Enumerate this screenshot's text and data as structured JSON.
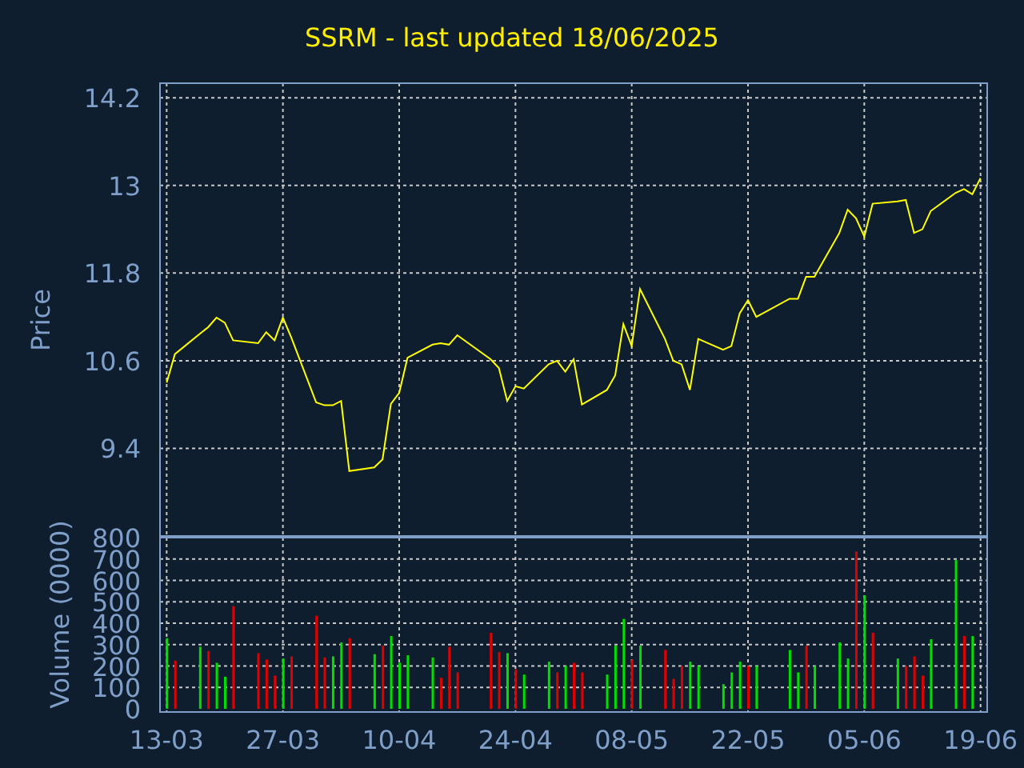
{
  "title": "SSRM - last updated 18/06/2025",
  "price_chart": {
    "chart_data": {
      "type": "line",
      "ylabel": "Price",
      "categories": [
        null,
        null,
        null,
        null,
        null,
        null,
        null,
        null,
        null,
        null,
        null,
        null,
        null,
        null,
        null,
        null,
        null,
        null,
        null,
        null,
        null,
        null,
        null,
        null,
        null,
        null,
        null,
        null,
        null,
        null,
        null,
        null,
        null,
        null,
        null,
        null,
        null,
        null,
        null,
        null,
        null,
        null,
        null,
        null,
        null,
        null,
        null,
        null,
        null,
        null,
        null,
        null,
        null,
        null,
        null,
        null,
        null,
        null,
        null,
        null,
        null,
        null,
        null,
        null,
        null,
        null,
        null,
        null,
        null,
        null,
        null,
        null,
        null,
        null,
        null,
        null,
        null,
        null,
        null,
        null,
        null,
        null,
        null,
        null,
        null,
        null,
        null,
        null,
        null,
        null,
        null,
        null,
        null,
        null,
        null,
        null,
        null,
        null,
        null
      ],
      "series": [
        {
          "color": "#ffff00",
          "values": [
            10.3,
            10.69,
            null,
            null,
            10.97,
            11.06,
            11.19,
            11.12,
            10.88,
            null,
            null,
            10.84,
            10.99,
            10.88,
            11.19,
            10.92,
            null,
            null,
            10.03,
            9.99,
            9.99,
            10.05,
            9.09,
            null,
            null,
            9.14,
            9.25,
            10.01,
            10.16,
            10.64,
            null,
            null,
            10.82,
            10.84,
            10.82,
            10.95,
            null,
            null,
            null,
            10.62,
            10.5,
            10.05,
            10.25,
            10.22,
            null,
            null,
            10.55,
            10.6,
            10.45,
            10.62,
            10.0,
            null,
            null,
            10.2,
            10.4,
            11.1,
            10.8,
            11.58,
            null,
            null,
            10.9,
            10.6,
            10.55,
            10.2,
            10.9,
            null,
            null,
            10.75,
            10.8,
            11.25,
            11.43,
            11.2,
            null,
            null,
            null,
            11.45,
            11.45,
            11.75,
            11.75,
            null,
            null,
            12.35,
            12.67,
            12.55,
            12.3,
            12.75,
            null,
            null,
            12.78,
            12.8,
            12.35,
            12.4,
            12.65,
            null,
            null,
            12.9,
            12.95,
            12.88,
            13.1
          ]
        }
      ],
      "grid": true,
      "ylim": [
        8.2,
        14.4
      ],
      "yticks": [
        9.4,
        10.6,
        11.8,
        13,
        14.2
      ]
    }
  },
  "volume_chart": {
    "chart_data": {
      "type": "bar",
      "ylabel": "Volume (0000)",
      "stacked": true,
      "categories": [
        "13-03",
        null,
        null,
        null,
        null,
        null,
        null,
        null,
        null,
        null,
        null,
        null,
        null,
        null,
        "27-03",
        null,
        null,
        null,
        null,
        null,
        null,
        null,
        null,
        null,
        null,
        null,
        null,
        null,
        "10-04",
        null,
        null,
        null,
        null,
        null,
        null,
        null,
        null,
        null,
        null,
        null,
        null,
        null,
        "24-04",
        null,
        null,
        null,
        null,
        null,
        null,
        null,
        null,
        null,
        null,
        null,
        null,
        null,
        "08-05",
        null,
        null,
        null,
        null,
        null,
        null,
        null,
        null,
        null,
        null,
        null,
        null,
        null,
        "22-05",
        null,
        null,
        null,
        null,
        null,
        null,
        null,
        null,
        null,
        null,
        null,
        null,
        null,
        "05-06",
        null,
        null,
        null,
        null,
        null,
        null,
        null,
        null,
        null,
        null,
        null,
        null,
        null,
        "19-06"
      ],
      "series": [
        {
          "color": "#00e000",
          "values": [
            330,
            null,
            null,
            null,
            290,
            null,
            215,
            150,
            null,
            null,
            null,
            null,
            null,
            null,
            235,
            null,
            null,
            null,
            null,
            null,
            245,
            310,
            null,
            null,
            null,
            255,
            null,
            340,
            215,
            250,
            null,
            null,
            240,
            null,
            null,
            null,
            null,
            null,
            null,
            null,
            null,
            260,
            null,
            160,
            null,
            null,
            220,
            null,
            200,
            null,
            null,
            null,
            null,
            160,
            295,
            420,
            null,
            295,
            null,
            null,
            null,
            null,
            null,
            220,
            200,
            null,
            null,
            115,
            170,
            220,
            null,
            200,
            null,
            null,
            null,
            275,
            170,
            null,
            200,
            null,
            null,
            310,
            235,
            null,
            530,
            null,
            null,
            null,
            235,
            null,
            null,
            null,
            325,
            null,
            null,
            695,
            null,
            340,
            null
          ]
        },
        {
          "color": "#e00000",
          "values": [
            null,
            225,
            null,
            null,
            null,
            270,
            null,
            null,
            480,
            null,
            null,
            260,
            230,
            155,
            null,
            245,
            null,
            null,
            435,
            240,
            null,
            null,
            330,
            null,
            null,
            null,
            295,
            null,
            null,
            null,
            null,
            null,
            null,
            145,
            290,
            170,
            null,
            null,
            null,
            355,
            265,
            null,
            185,
            null,
            null,
            null,
            null,
            170,
            null,
            215,
            170,
            null,
            null,
            null,
            null,
            null,
            230,
            null,
            null,
            null,
            275,
            140,
            200,
            null,
            null,
            null,
            null,
            null,
            null,
            null,
            200,
            null,
            null,
            null,
            null,
            null,
            null,
            295,
            null,
            null,
            null,
            null,
            null,
            735,
            null,
            355,
            null,
            null,
            null,
            200,
            245,
            155,
            null,
            null,
            null,
            null,
            340,
            null,
            null
          ]
        }
      ],
      "grid": true,
      "ylim": [
        0,
        800
      ],
      "yticks": [
        0,
        100,
        200,
        300,
        400,
        500,
        600,
        700,
        800
      ]
    }
  }
}
